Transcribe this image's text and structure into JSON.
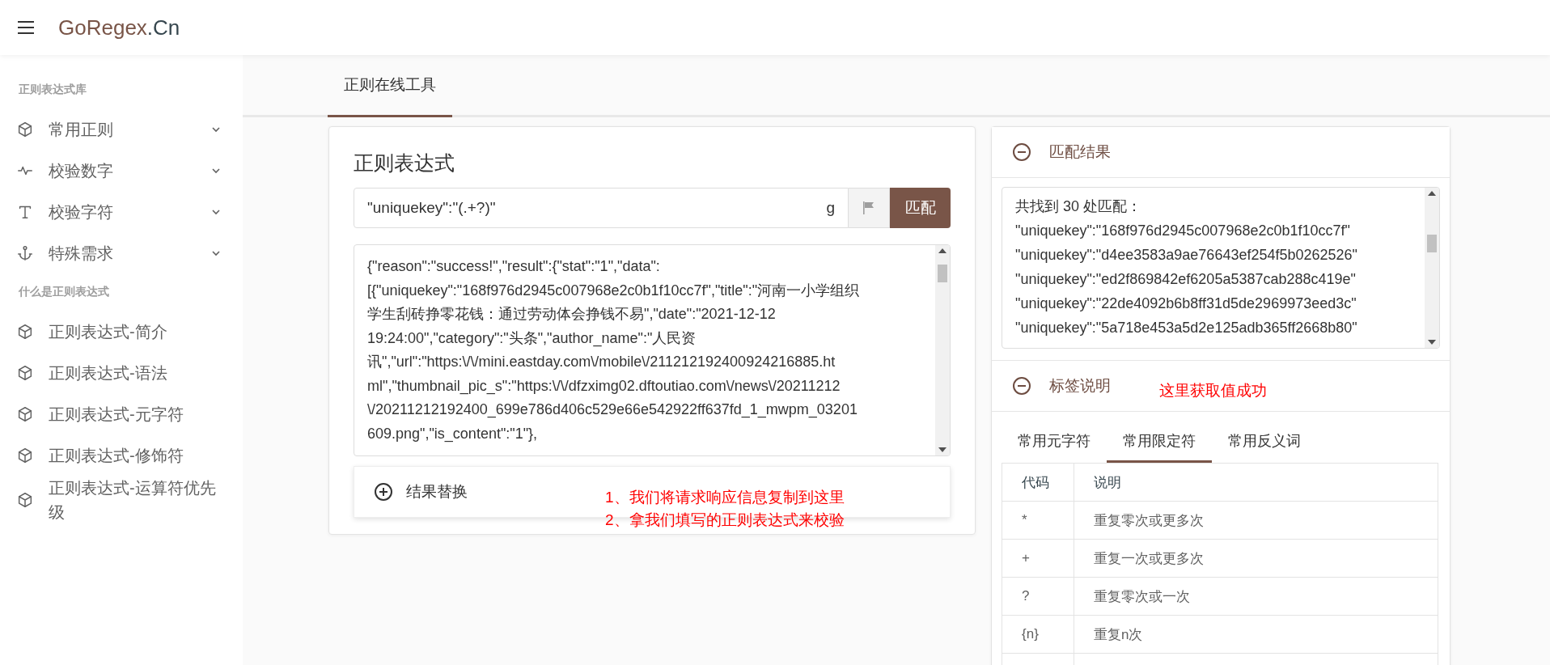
{
  "header": {
    "logo_main": "GoRegex",
    "logo_suffix": ".Cn"
  },
  "sidebar": {
    "sections": [
      {
        "heading": "正则表达式库",
        "items": [
          {
            "label": "常用正则",
            "expanded": false
          },
          {
            "label": "校验数字",
            "expanded": false
          },
          {
            "label": "校验字符",
            "expanded": false
          },
          {
            "label": "特殊需求",
            "expanded": false
          }
        ]
      },
      {
        "heading": "什么是正则表达式",
        "items": [
          {
            "label": "正则表达式-简介"
          },
          {
            "label": "正则表达式-语法"
          },
          {
            "label": "正则表达式-元字符"
          },
          {
            "label": "正则表达式-修饰符"
          },
          {
            "label": "正则表达式-运算符优先级"
          }
        ]
      }
    ]
  },
  "main_tabs": [
    {
      "label": "正则在线工具",
      "selected": true
    }
  ],
  "regex_panel": {
    "title": "正则表达式",
    "pattern": "\"uniquekey\":\"(.+?)\"",
    "flags": "g",
    "match_button": "匹配",
    "text_lines": [
      "{\"reason\":\"success!\",\"result\":{\"stat\":\"1\",\"data\":",
      "[{\"uniquekey\":\"168f976d2945c007968e2c0b1f10cc7f\",\"title\":\"河南一小学组织",
      "学生刮砖挣零花钱：通过劳动体会挣钱不易\",\"date\":\"2021-12-12",
      "19:24:00\",\"category\":\"头条\",\"author_name\":\"人民资",
      "讯\",\"url\":\"https:\\/\\/mini.eastday.com\\/mobile\\/211212192400924216885.ht",
      "ml\",\"thumbnail_pic_s\":\"https:\\/\\/dfzximg02.dftoutiao.com\\/news\\/20211212",
      "\\/20211212192400_699e786d406c529e66e542922ff637fd_1_mwpm_03201",
      "609.png\",\"is_content\":\"1\"},"
    ],
    "replace_section": {
      "label": "结果替换",
      "expanded": false
    }
  },
  "results_panel": {
    "title": "匹配结果",
    "expanded": true,
    "lines": [
      "共找到 30 处匹配：",
      "\"uniquekey\":\"168f976d2945c007968e2c0b1f10cc7f\"",
      "\"uniquekey\":\"d4ee3583a9ae76643ef254f5b0262526\"",
      "\"uniquekey\":\"ed2f869842ef6205a5387cab288c419e\"",
      "\"uniquekey\":\"22de4092b6b8ff31d5de2969973eed3c\"",
      "\"uniquekey\":\"5a718e453a5d2e125adb365ff2668b80\""
    ]
  },
  "legend_panel": {
    "title": "标签说明",
    "expanded": true,
    "tabs": [
      {
        "label": "常用元字符",
        "selected": false
      },
      {
        "label": "常用限定符",
        "selected": true
      },
      {
        "label": "常用反义词",
        "selected": false
      }
    ],
    "table": {
      "columns": [
        "代码",
        "说明"
      ],
      "rows": [
        [
          "*",
          "重复零次或更多次"
        ],
        [
          "+",
          "重复一次或更多次"
        ],
        [
          "?",
          "重复零次或一次"
        ],
        [
          "{n}",
          "重复n次"
        ]
      ]
    }
  },
  "annotations": [
    {
      "text": "1、我们将请求响应信息复制到这里"
    },
    {
      "text": "2、拿我们填写的正则表达式来校验"
    },
    {
      "text": "这里获取值成功"
    }
  ]
}
